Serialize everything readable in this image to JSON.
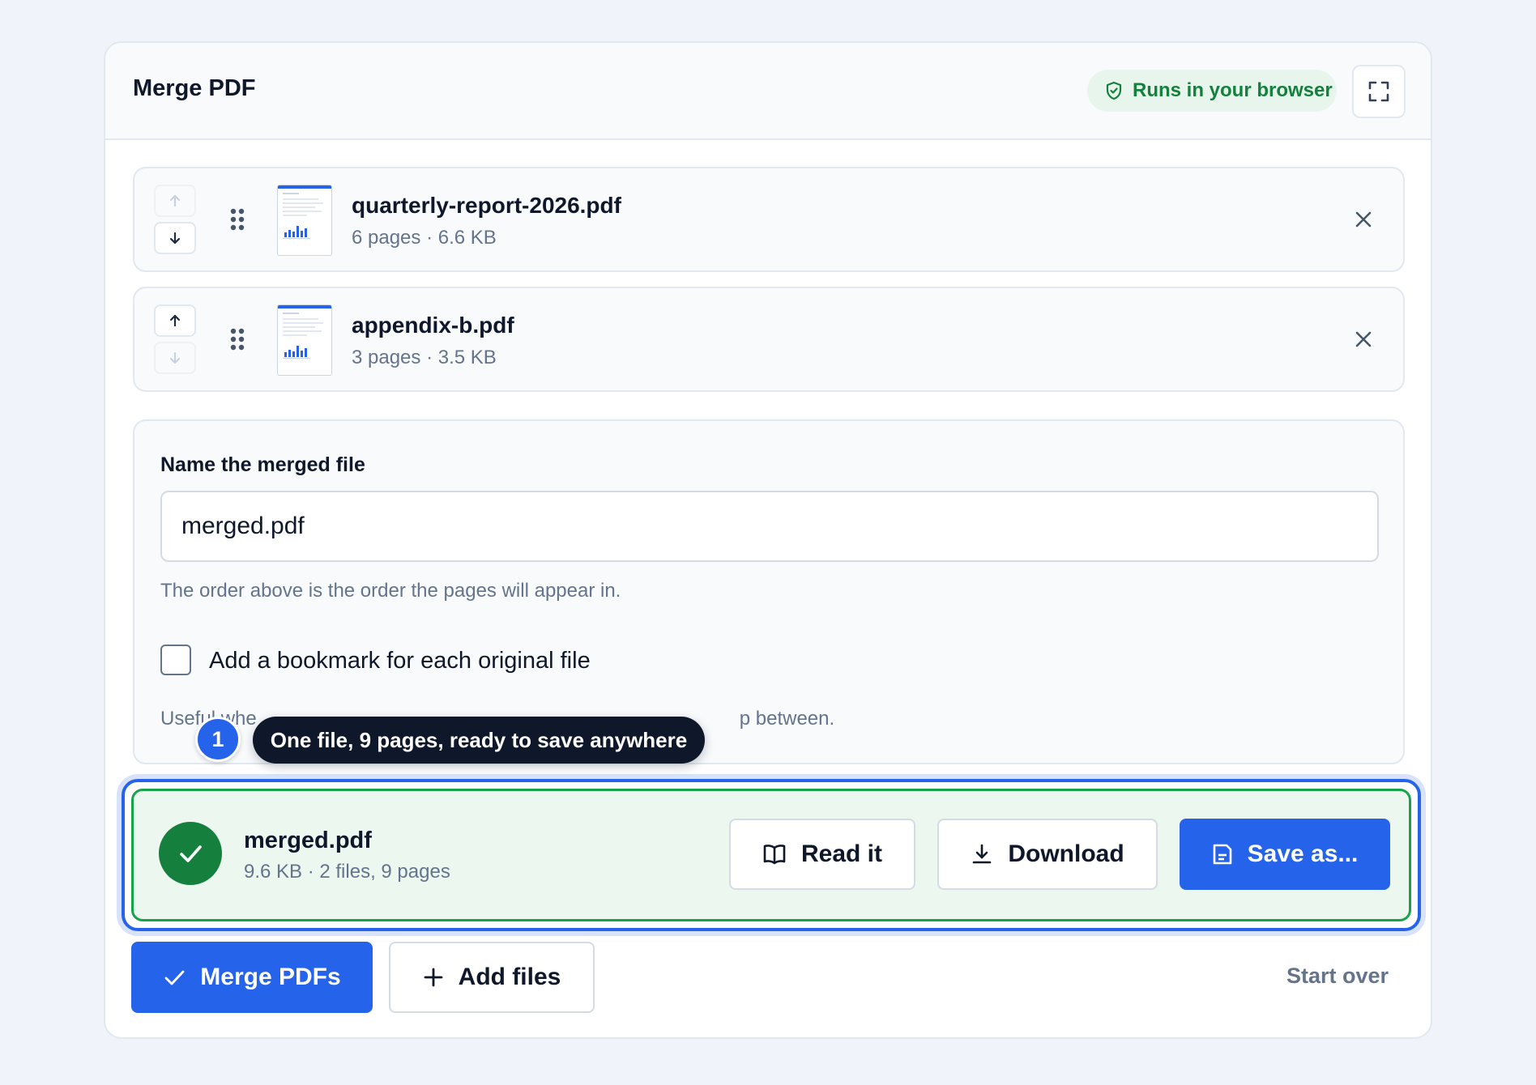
{
  "header": {
    "title": "Merge PDF",
    "badge": "Runs in your browser",
    "badge_icon": "shield-check-icon",
    "fullscreen_icon": "fullscreen-icon"
  },
  "files": [
    {
      "name": "quarterly-report-2026.pdf",
      "meta": "6 pages · 6.6 KB",
      "up_disabled": true,
      "down_disabled": false
    },
    {
      "name": "appendix-b.pdf",
      "meta": "3 pages · 3.5 KB",
      "up_disabled": false,
      "down_disabled": true
    }
  ],
  "options": {
    "name_label": "Name the merged file",
    "name_value": "merged.pdf",
    "order_hint": "The order above is the order the pages will appear in.",
    "bookmark_label": "Add a bookmark for each original file",
    "bookmark_checked": false,
    "bookmark_hint_start": "Useful whe",
    "bookmark_hint_end": "p between."
  },
  "tooltip": {
    "step": "1",
    "text": "One file, 9 pages, ready to save anywhere"
  },
  "result": {
    "name": "merged.pdf",
    "meta": "9.6 KB · 2 files, 9 pages",
    "read_label": "Read it",
    "download_label": "Download",
    "save_label": "Save as..."
  },
  "footer": {
    "merge_label": "Merge PDFs",
    "add_label": "Add files",
    "start_over_label": "Start over"
  },
  "colors": {
    "accent": "#2563eb",
    "success": "#15803d",
    "success_bg": "#ebf7ef",
    "badge_bg": "#e8f5ec"
  }
}
